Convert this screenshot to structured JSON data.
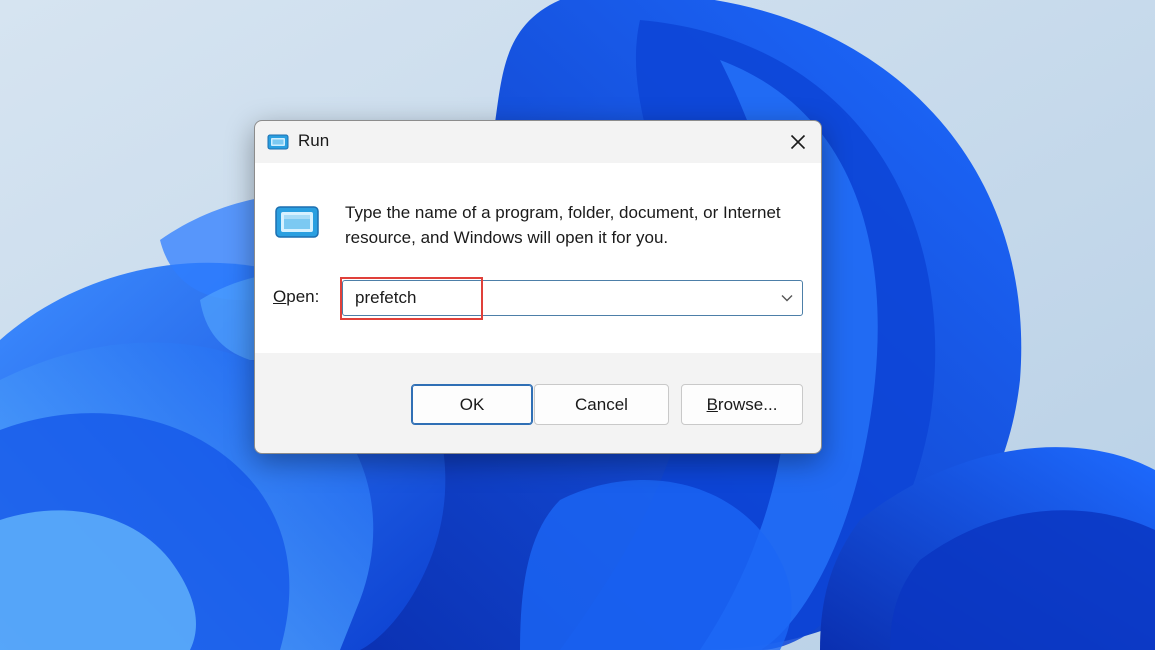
{
  "dialog": {
    "title": "Run",
    "description": "Type the name of a program, folder, document, or Internet resource, and Windows will open it for you.",
    "open_label_mnemonic": "O",
    "open_label_rest": "pen:",
    "open_value": "prefetch",
    "ok_label": "OK",
    "cancel_label": "Cancel",
    "browse_mnemonic": "B",
    "browse_rest": "rowse..."
  },
  "icons": {
    "title": "run-icon",
    "app": "run-icon",
    "close": "close-icon",
    "dropdown": "chevron-down-icon"
  },
  "colors": {
    "accent": "#2f6fb5",
    "highlight": "#e0403a",
    "wallpaper": "#1a5ff0"
  }
}
